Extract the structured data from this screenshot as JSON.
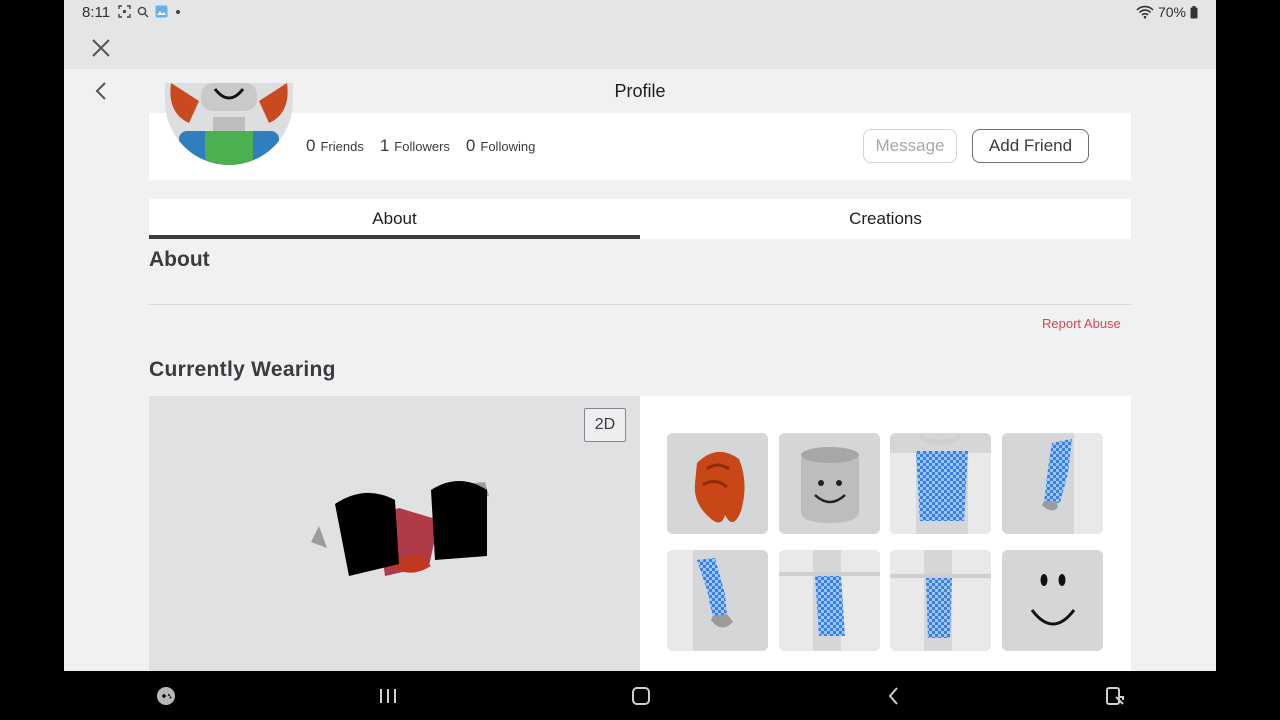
{
  "status": {
    "time": "8:11",
    "battery": "70%"
  },
  "header": {
    "title": "Profile"
  },
  "profile": {
    "stats": [
      {
        "count": "0",
        "label": "Friends"
      },
      {
        "count": "1",
        "label": "Followers"
      },
      {
        "count": "0",
        "label": "Following"
      }
    ],
    "message_label": "Message",
    "add_friend_label": "Add Friend"
  },
  "tabs": [
    {
      "label": "About"
    },
    {
      "label": "Creations"
    }
  ],
  "about": {
    "title": "About",
    "report_label": "Report Abuse"
  },
  "wearing": {
    "title": "Currently Wearing",
    "toggle_label": "2D",
    "items": [
      {
        "name": "red-hair"
      },
      {
        "name": "head"
      },
      {
        "name": "blue-checkered-torso"
      },
      {
        "name": "blue-right-arm"
      },
      {
        "name": "blue-left-arm"
      },
      {
        "name": "blue-left-leg"
      },
      {
        "name": "blue-right-leg"
      },
      {
        "name": "smile-face"
      }
    ]
  },
  "colors": {
    "accent": "#393b3d",
    "report": "#d8454e",
    "check": "#3d7fe0"
  },
  "navbar": [
    "game-icon",
    "recent-apps-icon",
    "home-icon",
    "back-icon",
    "screen-icon"
  ]
}
